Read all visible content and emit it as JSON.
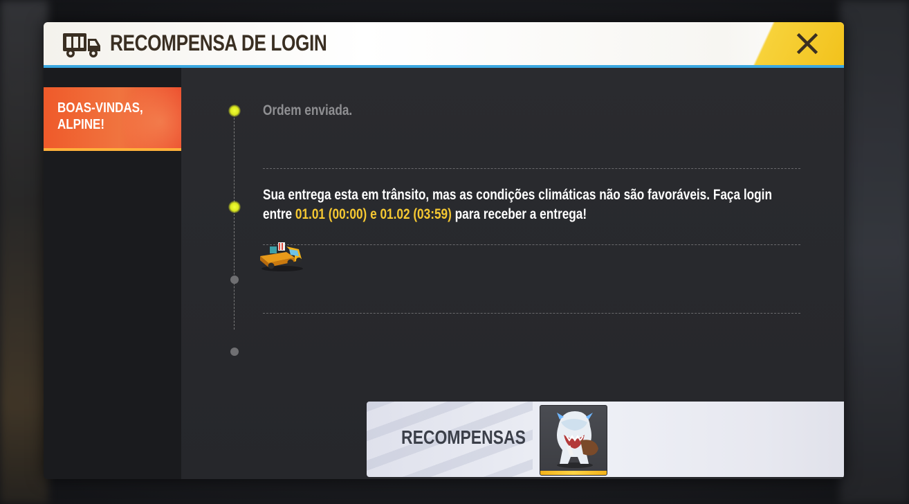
{
  "header": {
    "title": "RECOMPENSA DE LOGIN",
    "icon": "truck-icon",
    "close_icon": "close-icon"
  },
  "sidebar": {
    "items": [
      {
        "label": "BOAS-VINDAS, ALPINE!",
        "active": true
      }
    ]
  },
  "timeline": {
    "steps": [
      {
        "text": "Ordem enviada.",
        "state": "done"
      },
      {
        "text_before": "Sua entrega esta em trânsito, mas as condições climáticas não são favoráveis. Faça login entre ",
        "date_start": "01.01 (00:00)",
        "text_middle": " e ",
        "date_end": "01.02 (03:59)",
        "text_after": " para receber a entrega!",
        "state": "current"
      },
      {
        "icon": "tow-truck-icon",
        "state": "pending"
      },
      {
        "state": "pending"
      }
    ]
  },
  "rewards": {
    "label": "RECOMPENSAS",
    "items": [
      {
        "icon": "yeti-pet-icon"
      }
    ]
  },
  "colors": {
    "accent_yellow": "#f5c832",
    "header_border": "#3aa7e0",
    "tab_active": "#ef5a2a",
    "close_bg": "#f2c21c"
  }
}
